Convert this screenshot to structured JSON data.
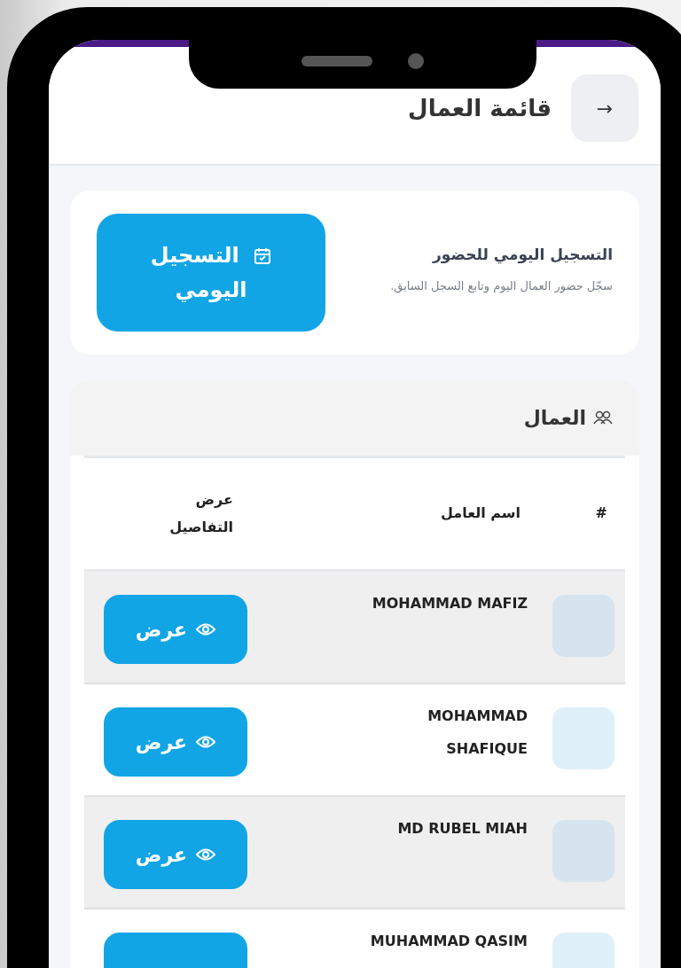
{
  "screen": {
    "title": "قائمة العمال",
    "back_button": "→"
  },
  "attendance_card": {
    "title": "التسجيل اليومي للحضور",
    "description": "سجّل حضور العمال اليوم وتابع السجل السابق.",
    "button": "التسجيل اليومي"
  },
  "workers": {
    "title": "العمال",
    "columns": [
      "#",
      "اسم العامل",
      "عرض التفاصيل"
    ],
    "rows": [
      {
        "name": "MOHAMMAD MAFIZ",
        "action": "عرض"
      },
      {
        "name": "MOHAMMAD SHAFIQUE",
        "action": "عرض"
      },
      {
        "name": "MD RUBEL MIAH",
        "action": "عرض"
      },
      {
        "name": "MUHAMMAD QASIM"
      }
    ]
  }
}
